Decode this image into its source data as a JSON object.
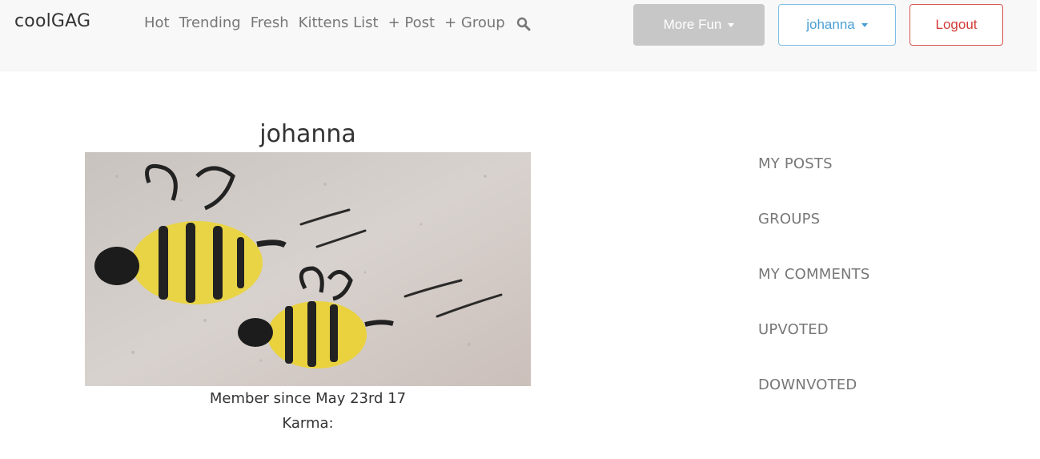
{
  "navbar": {
    "brand": "coolGAG",
    "links": [
      "Hot",
      "Trending",
      "Fresh",
      "Kittens List",
      "+ Post",
      "+ Group"
    ],
    "search_icon": "search-icon",
    "more_fun_label": "More Fun",
    "user_label": "johanna",
    "logout_label": "Logout"
  },
  "profile": {
    "name": "johanna",
    "member_since": "Member since May 23rd 17",
    "karma": "Karma:"
  },
  "side_menu": [
    "MY POSTS",
    "GROUPS",
    "MY COMMENTS",
    "UPVOTED",
    "DOWNVOTED"
  ],
  "colors": {
    "navbar_bg": "#f8f8f8",
    "more_fun_bg": "#c7c7c7",
    "user_button_border": "#7cbde6",
    "logout_border": "#d9534f"
  }
}
